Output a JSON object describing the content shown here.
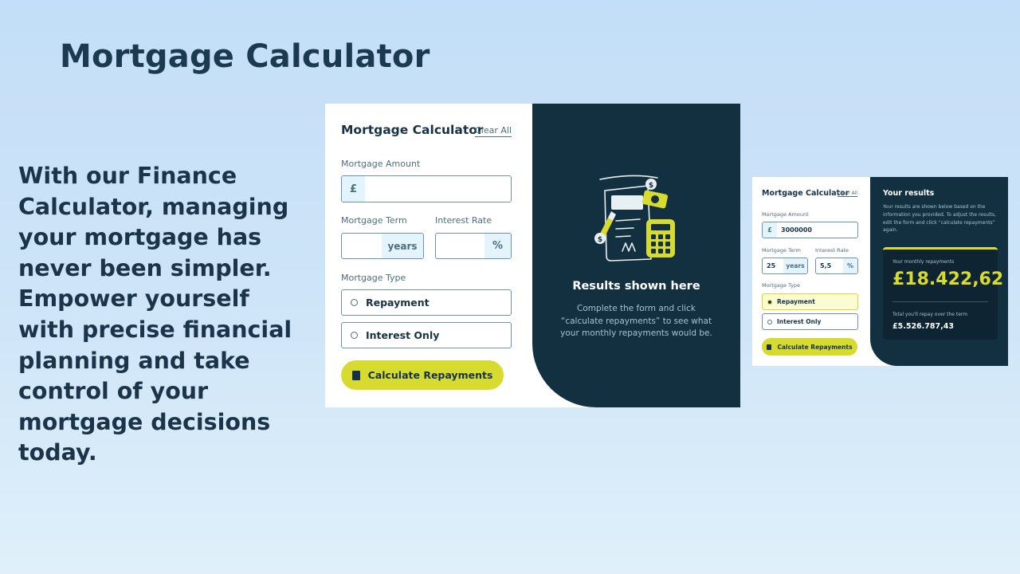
{
  "slide": {
    "title": "Mortgage Calculator",
    "body": "With our Finance Calculator, managing your mortgage has never been simpler. Empower yourself with precise financial planning and take control of your mortgage decisions today."
  },
  "colors": {
    "background": "#c3def8",
    "dark": "#133041",
    "accent": "#d8db2f",
    "label": "#4e6e7e"
  },
  "empty_calculator": {
    "title": "Mortgage Calculator",
    "clear_all": "Clear All",
    "amount_label": "Mortgage Amount",
    "currency": "£",
    "amount_value": "",
    "term_label": "Mortgage Term",
    "term_value": "",
    "term_unit": "years",
    "rate_label": "Interest Rate",
    "rate_value": "",
    "rate_unit": "%",
    "type_label": "Mortgage Type",
    "options": [
      "Repayment",
      "Interest Only"
    ],
    "button": "Calculate Repayments",
    "button_icon": "calculator-icon",
    "illustration_icon": "calculator-illustration",
    "results_title": "Results shown here",
    "results_text": "Complete the form and click “calculate repayments” to see what your monthly repayments would be."
  },
  "filled_calculator": {
    "title": "Mortgage Calculator",
    "clear_all": "Clear All",
    "amount_label": "Mortgage Amount",
    "currency": "£",
    "amount_value": "3000000",
    "term_label": "Mortgage Term",
    "term_value": "25",
    "term_unit": "years",
    "rate_label": "Interest Rate",
    "rate_value": "5,5",
    "rate_unit": "%",
    "type_label": "Mortgage Type",
    "options": [
      "Repayment",
      "Interest Only"
    ],
    "selected_option": "Repayment",
    "button": "Calculate Repayments",
    "results_title": "Your results",
    "results_text": "Your results are shown below based on the information you provided. To adjust the results, edit the form and click “calculate repayments” again.",
    "monthly_label": "Your monthly repayments",
    "monthly_value": "£18.422,62",
    "total_label": "Total you'll repay over the term",
    "total_value": "£5.526.787,43"
  }
}
